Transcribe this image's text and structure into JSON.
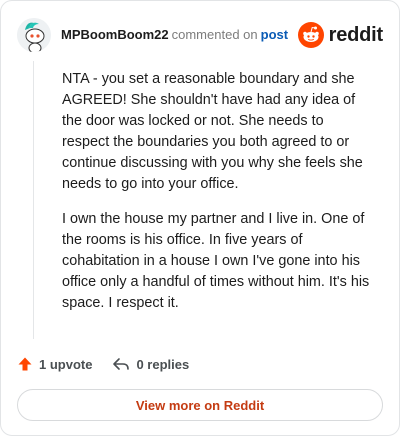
{
  "header": {
    "username": "MPBoomBoom22",
    "action_text": "commented on",
    "post_link": "post",
    "brand": "reddit"
  },
  "comment": {
    "paragraphs": [
      "NTA - you set a reasonable boundary and she AGREED! She shouldn't have had any idea of the door was locked or not. She needs to respect the boundaries you both agreed to or continue discussing with you why she feels she needs to go into your office.",
      "I own the house my partner and I live in. One of the rooms is his office. In five years of cohabitation in a house I own I've gone into his office only a handful of times without him. It's his space. I respect it."
    ]
  },
  "actions": {
    "upvotes": "1 upvote",
    "replies": "0 replies"
  },
  "footer": {
    "view_more": "View more on Reddit"
  },
  "colors": {
    "brand_orange": "#ff4500",
    "link_blue": "#0a5bb5",
    "cta_text": "#c43b12"
  },
  "icons": {
    "avatar": "snoo-avatar",
    "brand": "reddit-logo-icon",
    "upvote": "upvote-arrow-icon",
    "reply": "reply-arrow-icon"
  }
}
